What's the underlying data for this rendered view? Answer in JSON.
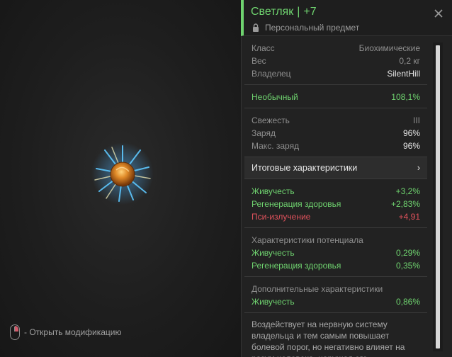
{
  "preview": {
    "hint_text": "- Открыть модификацию"
  },
  "header": {
    "name": "Светляк",
    "separator": "|",
    "level": "+7",
    "subtitle": "Персональный предмет",
    "accent_color": "#6fd36f"
  },
  "info": {
    "rows": [
      {
        "label": "Класс",
        "value": "Биохимические"
      },
      {
        "label": "Вес",
        "value": "0,2 кг"
      },
      {
        "label": "Владелец",
        "value": "SilentHill"
      }
    ]
  },
  "rarity": {
    "label": "Необычный",
    "value": "108,1%"
  },
  "condition": {
    "rows": [
      {
        "label": "Свежесть",
        "value": "III"
      },
      {
        "label": "Заряд",
        "value": "96%"
      },
      {
        "label": "Макс. заряд",
        "value": "96%"
      }
    ]
  },
  "summary": {
    "label": "Итоговые характеристики",
    "arrow": "›"
  },
  "final_stats": [
    {
      "label": "Живучесть",
      "value": "+3,2%",
      "color": "#6fd36f"
    },
    {
      "label": "Регенерация здоровья",
      "value": "+2,83%",
      "color": "#6fd36f"
    },
    {
      "label": "Пси-излучение",
      "value": "+4,91",
      "color": "#e0525c"
    }
  ],
  "potential": {
    "title": "Характеристики потенциала",
    "rows": [
      {
        "label": "Живучесть",
        "value": "0,29%"
      },
      {
        "label": "Регенерация здоровья",
        "value": "0,35%"
      }
    ]
  },
  "additional": {
    "title": "Дополнительные характеристики",
    "rows": [
      {
        "label": "Живучесть",
        "value": "0,86%"
      }
    ]
  },
  "description": "Воздействует на нервную систему владельца и тем самым повышает болевой порог, но негативно влияет на разум человека, нарушая его"
}
